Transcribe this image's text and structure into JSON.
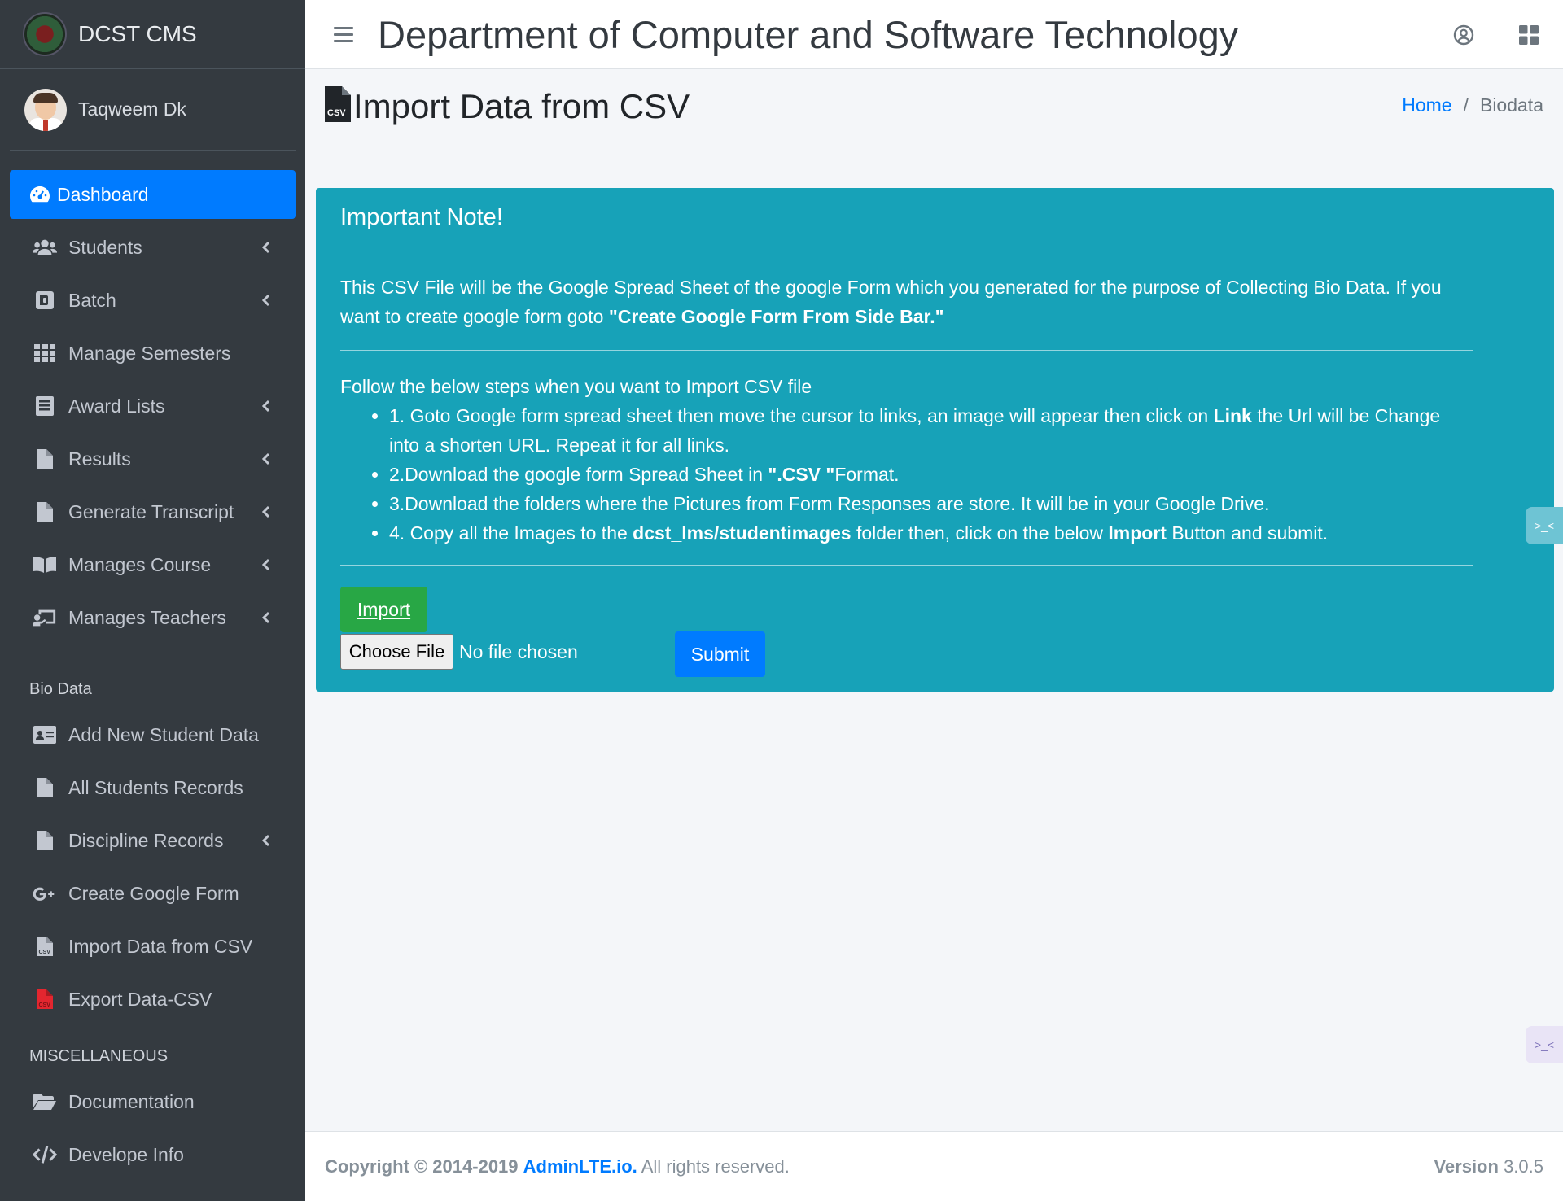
{
  "brand": {
    "name": "DCST CMS"
  },
  "user": {
    "name": "Taqweem Dk"
  },
  "sidebar": {
    "items": [
      {
        "label": "Dashboard",
        "icon": "tachometer-icon",
        "active": true
      },
      {
        "label": "Students",
        "icon": "users-icon",
        "has_submenu": true
      },
      {
        "label": "Batch",
        "icon": "batch-icon",
        "has_submenu": true
      },
      {
        "label": "Manage Semesters",
        "icon": "grid-icon"
      },
      {
        "label": "Award Lists",
        "icon": "list-icon",
        "has_submenu": true
      },
      {
        "label": "Results",
        "icon": "file-icon",
        "has_submenu": true
      },
      {
        "label": "Generate Transcript",
        "icon": "file-icon",
        "has_submenu": true
      },
      {
        "label": "Manages Course",
        "icon": "book-icon",
        "has_submenu": true
      },
      {
        "label": "Manages Teachers",
        "icon": "chalkboard-teacher-icon",
        "has_submenu": true
      }
    ],
    "header_bio": "Bio Data",
    "bio_items": [
      {
        "label": "Add New Student Data",
        "icon": "id-card-icon"
      },
      {
        "label": "All Students Records",
        "icon": "file-icon"
      },
      {
        "label": "Discipline Records",
        "icon": "file-icon",
        "has_submenu": true
      },
      {
        "label": "Create Google Form",
        "icon": "google-plus-icon"
      },
      {
        "label": "Import Data from CSV",
        "icon": "file-csv-icon"
      },
      {
        "label": "Export Data-CSV",
        "icon": "file-csv-red-icon"
      }
    ],
    "header_misc": "MISCELLANEOUS",
    "misc_items": [
      {
        "label": "Documentation",
        "icon": "folder-open-icon"
      },
      {
        "label": "Develope Info",
        "icon": "code-icon"
      }
    ]
  },
  "topbar": {
    "title": "Department of Computer and Software Technology"
  },
  "page": {
    "title": "Import Data from CSV",
    "breadcrumb": {
      "home": "Home",
      "separator": "/",
      "current": "Biodata"
    }
  },
  "note": {
    "title": "Important Note!",
    "para_text": "This CSV File will be the Google Spread Sheet of the google Form which you generated for the purpose of Collecting Bio Data. If you want to create google form goto",
    "para_bold": "\"Create Google Form From Side Bar.\"",
    "steps_intro": "Follow the below steps when you want to Import CSV file",
    "step1_a": "1. Goto Google form spread sheet then move the cursor to links, an image will appear then click on",
    "step1_bold": "Link",
    "step1_b": "the Url will be Change into a shorten URL. Repeat it for all links.",
    "step2_a": "2.Download the google form Spread Sheet in",
    "step2_bold": "\".CSV \"",
    "step2_b": "Format.",
    "step3": "3.Download the folders where the Pictures from Form Responses are store. It will be in your Google Drive.",
    "step4_a": "4. Copy all the Images to the",
    "step4_bold": "dcst_lms/studentimages",
    "step4_b": "folder then, click on the below",
    "step4_bold2": "Import",
    "step4_c": "Button and submit."
  },
  "form": {
    "import_label": "Import",
    "choose_file_label": "Choose File",
    "no_file_text": "No file chosen",
    "submit_label": "Submit"
  },
  "footer": {
    "copyright": "Copyright © 2014-2019",
    "link": "AdminLTE.io.",
    "rights": "All rights reserved.",
    "version_label": "Version",
    "version": "3.0.5"
  },
  "colors": {
    "primary": "#007bff",
    "info": "#17a2b8",
    "success": "#28a745",
    "sidebar": "#343a40"
  }
}
